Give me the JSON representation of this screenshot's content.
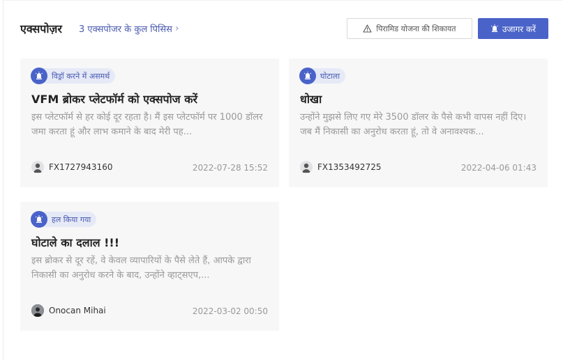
{
  "header": {
    "title": "एक्सपोज़र",
    "count_text": "3 एक्सपोजर के कुल पिसिस",
    "complaint_label": "पिरामिड योजना की शिकायत",
    "expose_label": "उजागर करें"
  },
  "colors": {
    "accent": "#4a63c9",
    "badge_bg": "#e6eaf7",
    "card_bg": "#f7f7f8",
    "muted_text": "#9a9a9a"
  },
  "cards": [
    {
      "status": "विड्रॉ करने में असमर्थ",
      "status_icon": "bug-alert-icon",
      "title": "VFM ब्रोकर प्लेटफॉर्म को एक्सपोज करें",
      "body": "इस प्लेटफॉर्म से हर कोई दूर रहता है। मैं इस प्लेटफॉर्म पर 1000 डॉलर जमा करता हूं और लाभ कमाने के बाद मेरी पह...",
      "author": "FX1727943160",
      "avatar": "default-user-avatar",
      "date": "2022-07-28 15:52"
    },
    {
      "status": "घोटाला",
      "status_icon": "bug-alert-icon",
      "title": "धोखा",
      "body": "उन्होंने मुझसे लिए गए मेरे 3500 डॉलर के पैसे कभी वापस नहीं दिए। जब मैं निकासी का अनुरोध करता हूं, तो वे अनावश्यक...",
      "author": "FX1353492725",
      "avatar": "default-user-avatar",
      "date": "2022-04-06 01:43"
    },
    {
      "status": "हल किया गया",
      "status_icon": "bug-alert-icon",
      "title": "घोटाले का दलाल !!!",
      "body": "इस ब्रोकर से दूर रहें, वे केवल व्यापारियों के पैसे लेते हैं, आपके द्वारा निकासी का अनुरोध करने के बाद, उन्होंने व्हाट्सएप,...",
      "author": "Onocan Mihai",
      "avatar": "photo-avatar",
      "date": "2022-03-02 00:50"
    }
  ]
}
